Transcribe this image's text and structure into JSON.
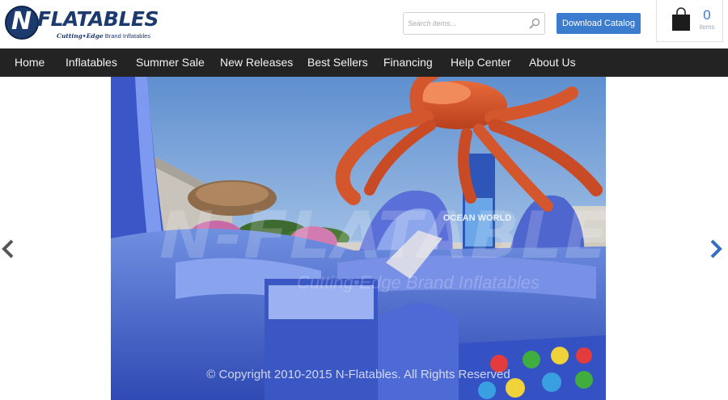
{
  "header": {
    "logo": {
      "initial": "N",
      "word": "FLATABLES",
      "tagline_brand": "Cutting•Edge",
      "tagline_rest": "Brand Inflatables"
    },
    "search": {
      "placeholder": "Search items...",
      "value": ""
    },
    "catalog_button": "Download Catalog",
    "cart": {
      "count": "0",
      "label": "items"
    }
  },
  "nav": {
    "items": [
      {
        "label": "Home"
      },
      {
        "label": "Inflatables"
      },
      {
        "label": "Summer Sale"
      },
      {
        "label": "New Releases"
      },
      {
        "label": "Best Sellers"
      },
      {
        "label": "Financing"
      },
      {
        "label": "Help Center"
      },
      {
        "label": "About Us"
      }
    ]
  },
  "slider": {
    "copyright": "© Copyright 2010-2015 N-Flatables. All Rights Reserved",
    "watermark": {
      "word": "N-FLATABLES",
      "tagline": "Cutting•Edge Brand Inflatables"
    },
    "sign_text": "OCEAN WORLD"
  },
  "colors": {
    "brand_navy": "#1d3a6e",
    "accent_blue": "#3c7ccf",
    "nav_bg": "#232323"
  }
}
